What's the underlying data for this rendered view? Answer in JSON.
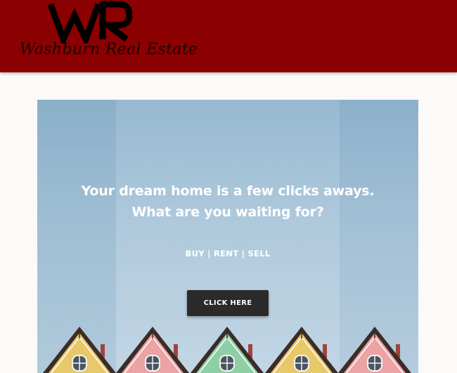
{
  "header": {
    "logo_mark": "WR",
    "logo_text": "Washburn Real Estate",
    "background_color": "#8b0000"
  },
  "hero": {
    "headline_line1": "Your dream home is a few clicks aways.",
    "headline_line2": "What are you waiting for?",
    "subnav": "BUY | RENT | SELL",
    "cta_label": "CLICK HERE",
    "roof_colors": [
      "#e7c86a",
      "#eba3a3",
      "#8fcfa6",
      "#e7c86a",
      "#eba3a3"
    ]
  }
}
